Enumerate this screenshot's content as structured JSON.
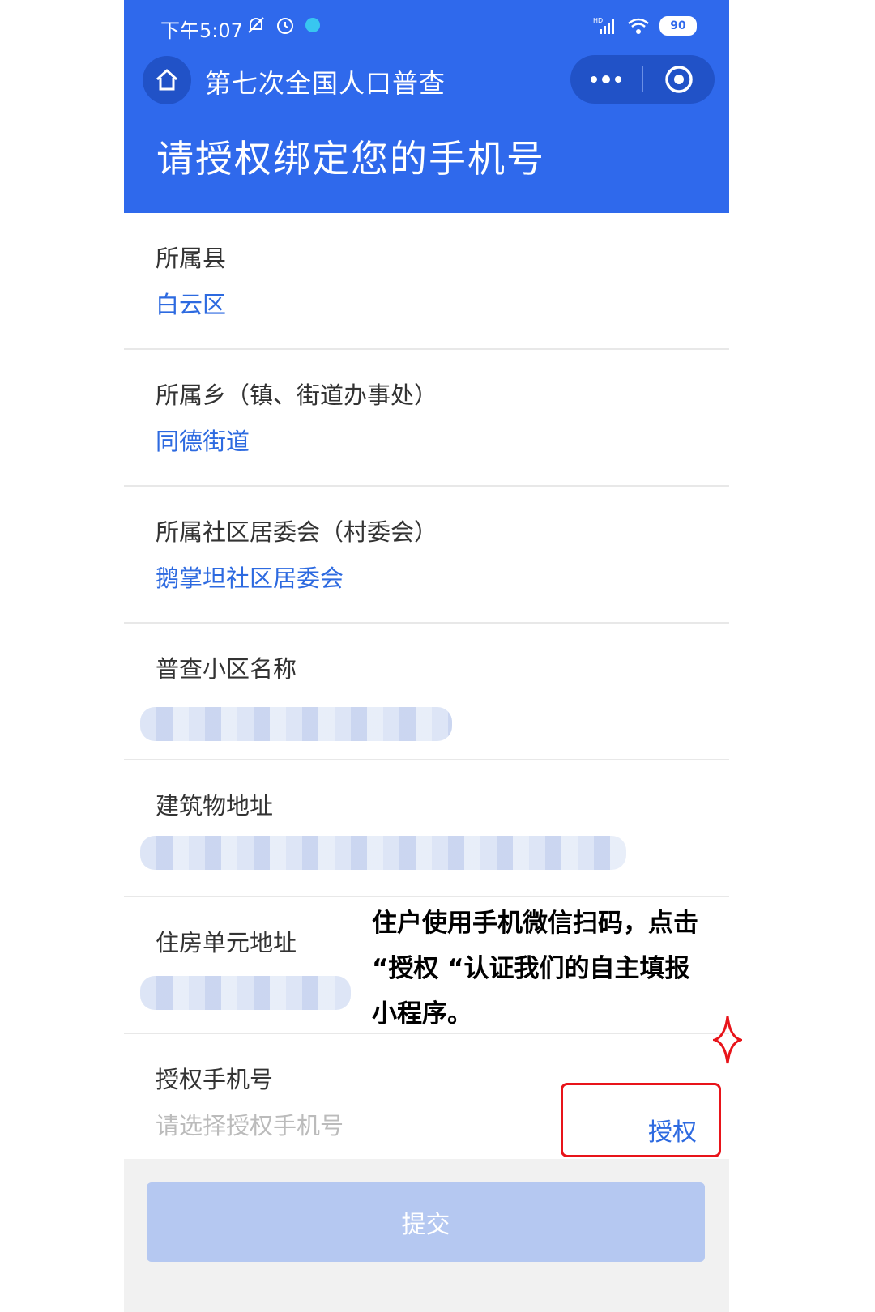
{
  "status": {
    "time": "下午5:07",
    "battery": "90",
    "network": "HD"
  },
  "nav": {
    "title": "第七次全国人口普查"
  },
  "page": {
    "title": "请授权绑定您的手机号"
  },
  "form": {
    "county": {
      "label": "所属县",
      "value": "白云区"
    },
    "township": {
      "label": "所属乡（镇、街道办事处）",
      "value": "同德街道"
    },
    "community": {
      "label": "所属社区居委会（村委会）",
      "value": "鹅掌坦社区居委会"
    },
    "census_area": {
      "label": "普查小区名称"
    },
    "building": {
      "label": "建筑物地址"
    },
    "unit": {
      "label": "住房单元地址"
    },
    "phone": {
      "label": "授权手机号",
      "placeholder": "请选择授权手机号",
      "auth_label": "授权"
    }
  },
  "submit": {
    "label": "提交"
  },
  "annotation": {
    "text": "住户使用手机微信扫码，点击 “授权 “认证我们的自主填报小程序。"
  },
  "colors": {
    "header": "#2f69ec",
    "accent": "#2d6ae0",
    "submit_disabled": "#b5c8f1",
    "highlight": "#e8141a"
  }
}
